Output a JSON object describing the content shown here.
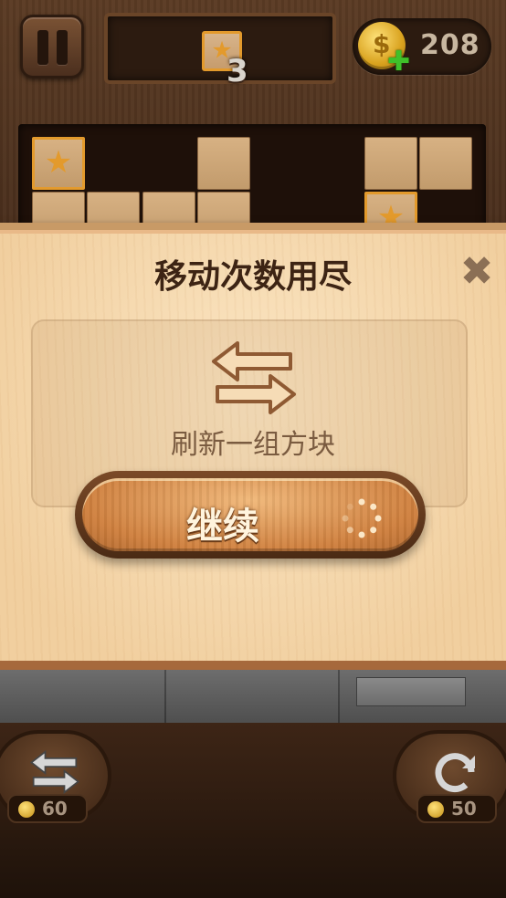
{
  "hud": {
    "target_count": "3",
    "coins": "208"
  },
  "modal": {
    "title": "移动次数用尽",
    "close_icon": "✖",
    "description": "刷新一组方块",
    "continue_label": "继续"
  },
  "powerups": {
    "swap_price": "60",
    "refresh_price": "50"
  }
}
